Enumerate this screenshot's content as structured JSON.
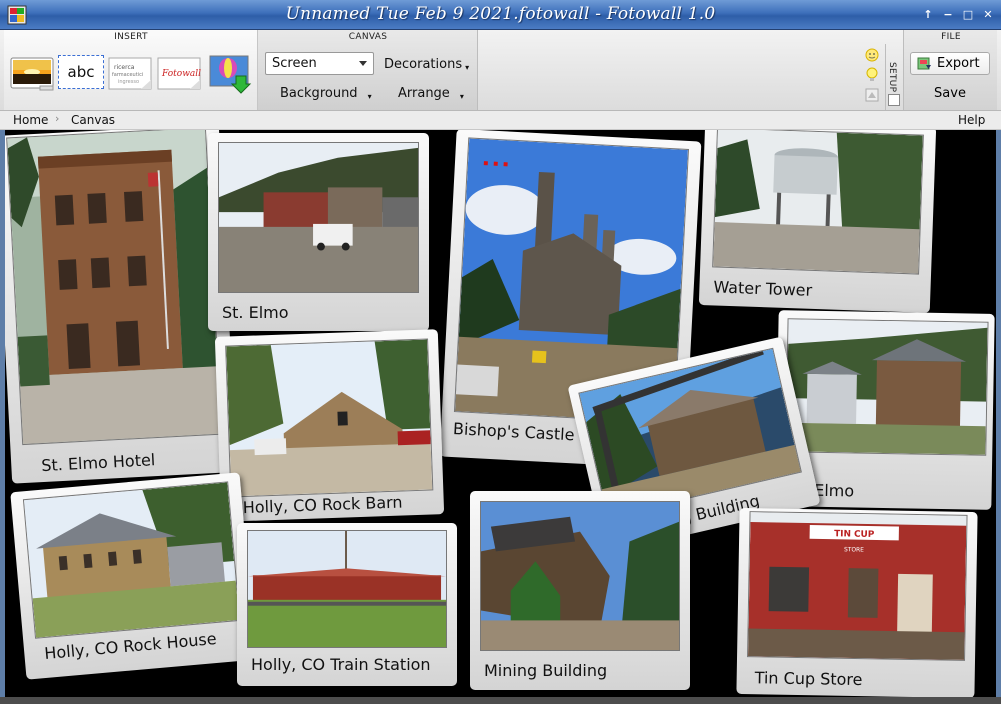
{
  "window": {
    "title": "Unnamed Tue Feb 9 2021.fotowall - Fotowall 1.0",
    "controls": [
      "↑",
      "−",
      "□",
      "✕"
    ]
  },
  "toolbar": {
    "insert": {
      "header": "INSERT",
      "text_button_label": "abc",
      "webcam_label": "Fotowall"
    },
    "canvas": {
      "header": "CANVAS",
      "mode_select": "Screen",
      "decorations_label": "Decorations",
      "background_label": "Background",
      "arrange_label": "Arrange"
    },
    "setup": {
      "label": "SETUP"
    },
    "file": {
      "header": "FILE",
      "export_label": "Export",
      "save_label": "Save"
    }
  },
  "breadcrumb": {
    "home": "Home",
    "canvas": "Canvas",
    "help": "Help"
  },
  "photos": [
    {
      "caption": "St. Elmo Hotel"
    },
    {
      "caption": "St. Elmo"
    },
    {
      "caption": "Bishop's Castle"
    },
    {
      "caption": "Water Tower"
    },
    {
      "caption": "Holly, CO Rock Barn"
    },
    {
      "caption": "St. Elmo"
    },
    {
      "caption": "Mining Building"
    },
    {
      "caption": "Holly, CO Rock House"
    },
    {
      "caption": "Holly, CO Train Station"
    },
    {
      "caption": "Mining Building"
    },
    {
      "caption": "Tin Cup Store"
    }
  ],
  "store_sign": {
    "name": "TIN CUP",
    "sub": "STORE"
  },
  "colors": {
    "accent": "#3d6fba",
    "canvas_bg": "#000000"
  }
}
